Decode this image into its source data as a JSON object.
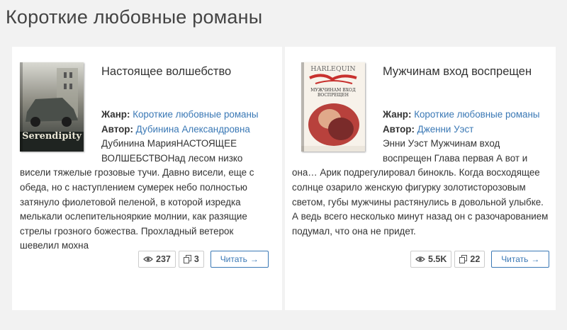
{
  "page": {
    "title": "Короткие любовные романы"
  },
  "books": [
    {
      "title": "Настоящее волшебство",
      "genre_label": "Жанр:",
      "genre": "Короткие любовные романы",
      "author_label": "Автор:",
      "author": "Дубинина Александровна",
      "excerpt": "Дубинина МарияНАСТОЯЩЕЕ ВОЛШЕБСТВОНад лесом низко висели тяжелые грозовые тучи. Давно висели, еще с обеда, но с наступлением сумерек небо полностью затянуло фиолетовой пеленой, в которой изредка мелькали ослепительнояркие молнии, как разящие стрелы грозного божества. Прохладный ветерок шевелил мохна",
      "cover_text": "Serendipity",
      "views": "237",
      "comments": "3",
      "read_label": "Читать",
      "read_arrow": "→"
    },
    {
      "title": "Мужчинам вход воспрещен",
      "genre_label": "Жанр:",
      "genre": "Короткие любовные романы",
      "author_label": "Автор:",
      "author": "Дженни Уэст",
      "excerpt": "Энни Уэст Мужчинам вход воспрещен Глава первая А вот и она… Арик подрегулировал бинокль. Когда восходящее солнце озарило женскую фигурку золотисторозовым светом, губы мужчины растянулись в довольной улыбке. А ведь всего несколько минут назад он с разочарованием подумал, что она не придет.",
      "cover_brand": "HARLEQUIN",
      "cover_text": "МУЖЧИНАМ ВХОД ВОСПРЕЩЕН",
      "views": "5.5K",
      "comments": "22",
      "read_label": "Читать",
      "read_arrow": "→"
    }
  ],
  "icons": {
    "views": "eye-icon",
    "comments": "copy-icon"
  },
  "colors": {
    "link": "#3a78b5",
    "background": "#f2f2f2",
    "card": "#ffffff"
  }
}
